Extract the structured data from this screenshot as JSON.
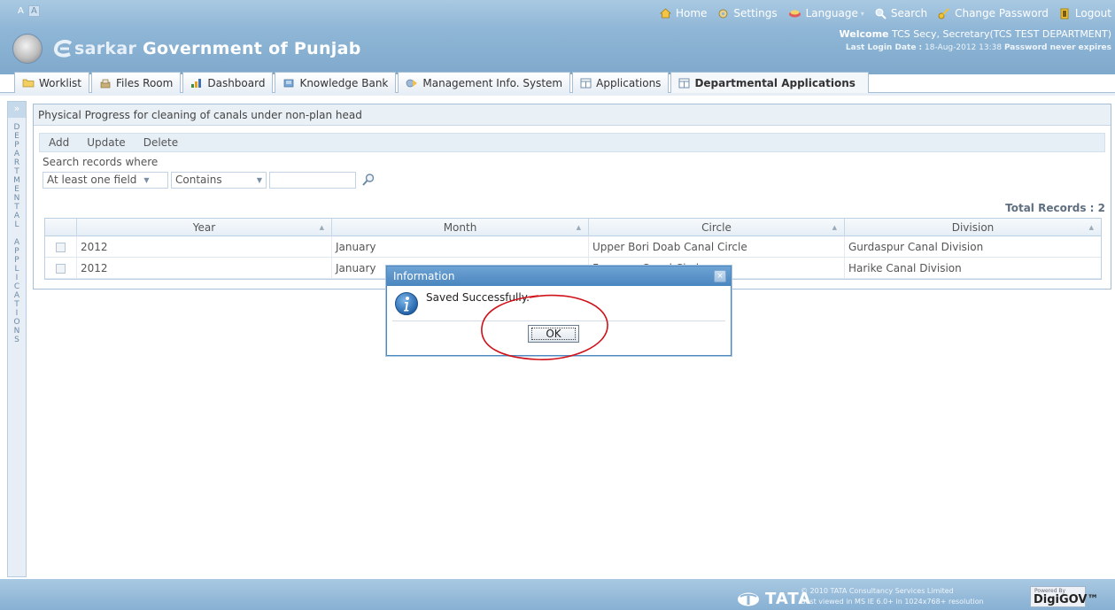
{
  "header": {
    "font_switch": {
      "small": "A",
      "large": "A"
    },
    "links": {
      "home": "Home",
      "settings": "Settings",
      "language": "Language",
      "search": "Search",
      "change_password": "Change Password",
      "logout": "Logout"
    },
    "brand_prefix": "sarkar",
    "brand_title": "Government of Punjab",
    "welcome_label": "Welcome",
    "welcome_user": "TCS Secy, Secretary(TCS TEST DEPARTMENT)",
    "last_login_label": "Last Login Date :",
    "last_login_value": "18-Aug-2012 13:38",
    "password_note": "Password never expires"
  },
  "tabs": [
    {
      "label": "Worklist",
      "icon": "folder-icon"
    },
    {
      "label": "Files Room",
      "icon": "files-icon"
    },
    {
      "label": "Dashboard",
      "icon": "chart-icon"
    },
    {
      "label": "Knowledge Bank",
      "icon": "book-icon"
    },
    {
      "label": "Management Info. System",
      "icon": "mis-icon"
    },
    {
      "label": "Applications",
      "icon": "grid-icon"
    },
    {
      "label": "Departmental Applications",
      "icon": "grid-icon",
      "active": true
    }
  ],
  "sidebar": {
    "expand": "»",
    "vertical_text": [
      "D",
      "E",
      "P",
      "A",
      "R",
      "T",
      "M",
      "E",
      "N",
      "T",
      "A",
      "L",
      "",
      "A",
      "P",
      "P",
      "L",
      "I",
      "C",
      "A",
      "T",
      "I",
      "O",
      "N",
      "S"
    ]
  },
  "panel": {
    "title": "Physical Progress for cleaning of canals under non-plan head",
    "toolbar": {
      "add": "Add",
      "update": "Update",
      "delete": "Delete"
    },
    "search_label": "Search records where",
    "search_field": "At least one field",
    "search_operator": "Contains",
    "search_value": "",
    "total_records_label": "Total Records : 2"
  },
  "grid": {
    "columns": [
      "Year",
      "Month",
      "Circle",
      "Division"
    ],
    "rows": [
      {
        "year": "2012",
        "month": "January",
        "circle": "Upper Bori Doab Canal  Circle",
        "division": "Gurdaspur Canal Division"
      },
      {
        "year": "2012",
        "month": "January",
        "circle": "Ferozpur Canal Circle",
        "division": "Harike Canal Division"
      }
    ]
  },
  "dialog": {
    "title": "Information",
    "close": "×",
    "message": "Saved Successfully.",
    "ok_label": "OK"
  },
  "footer": {
    "tata": "TATA",
    "copyright": "© 2010 TATA Consultancy Services Limited",
    "best_viewed": "Best viewed in MS IE 6.0+ in 1024x768+ resolution",
    "powered_by": "Powered By",
    "digigov": "DigiGOV™"
  },
  "colors": {
    "header_blue": "#8fb6d6",
    "dialog_title_blue": "#4a86bf",
    "annotation_red": "#d0121b"
  }
}
